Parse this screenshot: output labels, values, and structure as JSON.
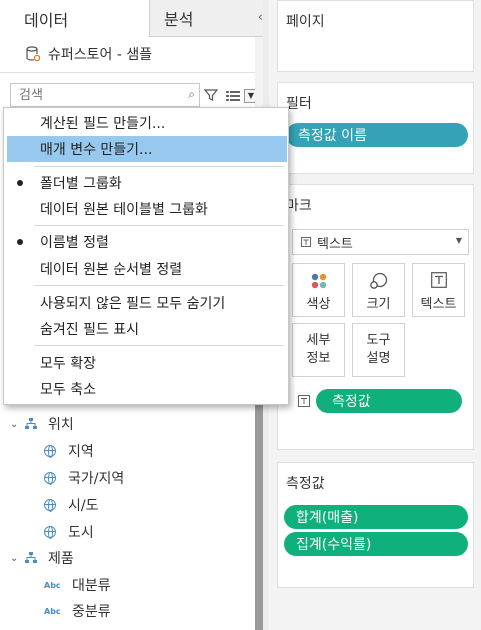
{
  "tabs": {
    "data": "데이터",
    "analysis": "분석"
  },
  "datasource": {
    "name": "슈퍼스토어 - 샘플"
  },
  "search": {
    "placeholder": "검색"
  },
  "menu": {
    "items": [
      {
        "label": "계산된 필드 만들기..."
      },
      {
        "label": "매개 변수 만들기..."
      },
      {
        "label": "폴더별 그룹화",
        "checked": true
      },
      {
        "label": "데이터 원본 테이블별 그룹화"
      },
      {
        "label": "이름별 정렬",
        "checked": true
      },
      {
        "label": "데이터 원본 순서별 정렬"
      },
      {
        "label": "사용되지 않은 필드 모두 숨기기"
      },
      {
        "label": "숨겨진 필드 표시"
      },
      {
        "label": "모두 확장"
      },
      {
        "label": "모두 축소"
      }
    ]
  },
  "tree": {
    "location": "위치",
    "region": "지역",
    "country": "국가/지역",
    "city": "시/도",
    "town": "도시",
    "product": "제품",
    "category": "대분류",
    "subcategory": "중분류"
  },
  "pages": {
    "title": "페이지"
  },
  "filters": {
    "title": "필터",
    "pill": "측정값 이름"
  },
  "marks": {
    "title": "마크",
    "type": "텍스트",
    "color": "색상",
    "size": "크기",
    "text": "텍스트",
    "detail": "세부\n정보",
    "tooltip": "도구\n설명",
    "detail_l1": "세부",
    "detail_l2": "정보",
    "tooltip_l1": "도구",
    "tooltip_l2": "설명",
    "text_pill": "측정값"
  },
  "measures": {
    "title": "측정값",
    "items": [
      "합계(매출)",
      "집계(수익률)"
    ]
  },
  "colors": {
    "teal": "#35a3b7",
    "green": "#10b07d",
    "highlight": "#97c8ee"
  }
}
